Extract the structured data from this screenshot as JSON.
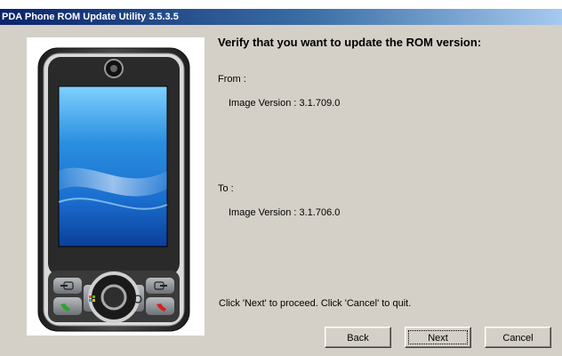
{
  "window": {
    "title": "PDA Phone ROM Update Utility 3.5.3.5"
  },
  "main": {
    "heading": "Verify that you want to update the ROM version:",
    "from_label": "From :",
    "from_version": "Image Version : 3.1.709.0",
    "to_label": "To :",
    "to_version": "Image Version : 3.1.706.0",
    "instruction": "Click 'Next' to proceed. Click 'Cancel' to quit."
  },
  "buttons": {
    "back": "Back",
    "next": "Next",
    "cancel": "Cancel"
  },
  "colors": {
    "dialog_bg": "#d4d0c8",
    "title_start": "#0a246a",
    "title_end": "#a6caf0",
    "screen_blue": "#1a6fd0"
  },
  "icons": [
    "pda-phone-illustration",
    "call-icon",
    "end-call-icon",
    "windows-start-icon",
    "ok-icon",
    "camera-icon",
    "dpad-icon"
  ]
}
